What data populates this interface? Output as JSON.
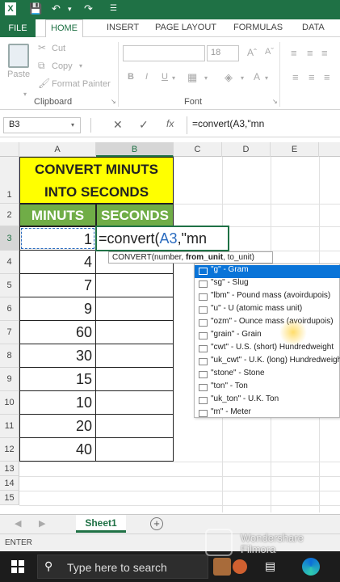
{
  "titlebar": {
    "app_icon": "excel-icon",
    "save_icon": "save-icon",
    "undo_icon": "undo-icon",
    "redo_icon": "redo-icon"
  },
  "tabs": [
    "FILE",
    "HOME",
    "INSERT",
    "PAGE LAYOUT",
    "FORMULAS",
    "DATA"
  ],
  "ribbon": {
    "paste": "Paste",
    "cut": "Cut",
    "copy": "Copy",
    "format_painter": "Format Painter",
    "clipboard_group": "Clipboard",
    "font_size": "18",
    "font_group": "Font",
    "bold": "B",
    "italic": "I",
    "underline": "U"
  },
  "formula_bar": {
    "name_box": "B3",
    "fx": "fx",
    "formula": "=convert(A3,\"mn"
  },
  "columns": [
    "A",
    "B",
    "C",
    "D",
    "E"
  ],
  "rows": [
    "1",
    "2",
    "3",
    "4",
    "5",
    "6",
    "7",
    "8",
    "9",
    "10",
    "11",
    "12",
    "13",
    "14",
    "15"
  ],
  "sheet": {
    "title_line1": "CONVERT MINUTS",
    "title_line2": "INTO SECONDS",
    "hdr_minutes": "MINUTS",
    "hdr_seconds": "SECONDS",
    "values": [
      "1",
      "4",
      "7",
      "9",
      "60",
      "30",
      "15",
      "10",
      "20",
      "40"
    ],
    "editing_prefix": "=convert(",
    "editing_ref": "A3",
    "editing_suffix": ",\"mn"
  },
  "tooltip": {
    "func": "CONVERT(number, ",
    "arg": "from_unit",
    "rest": ", to_unit)"
  },
  "autocomplete": [
    "\"g\" - Gram",
    "\"sg\" - Slug",
    "\"lbm\" - Pound mass (avoirdupois)",
    "\"u\" - U (atomic mass unit)",
    "\"ozm\" - Ounce mass (avoirdupois)",
    "\"grain\" - Grain",
    "\"cwt\" - U.S. (short) Hundredweight",
    "\"uk_cwt\" - U.K. (long) Hundredweight",
    "\"stone\" - Stone",
    "\"ton\" - Ton",
    "\"uk_ton\" - U.K. Ton",
    "\"m\" - Meter"
  ],
  "sheet_tab": "Sheet1",
  "status": "ENTER",
  "taskbar": {
    "search_placeholder": "Type here to search",
    "watermark1": "Wondershare",
    "watermark2": "Filmora"
  },
  "colors": {
    "excel_green": "#1f7145",
    "title_yellow": "#ffff00",
    "header_green": "#70ad47",
    "selection_blue": "#0a74d8"
  }
}
